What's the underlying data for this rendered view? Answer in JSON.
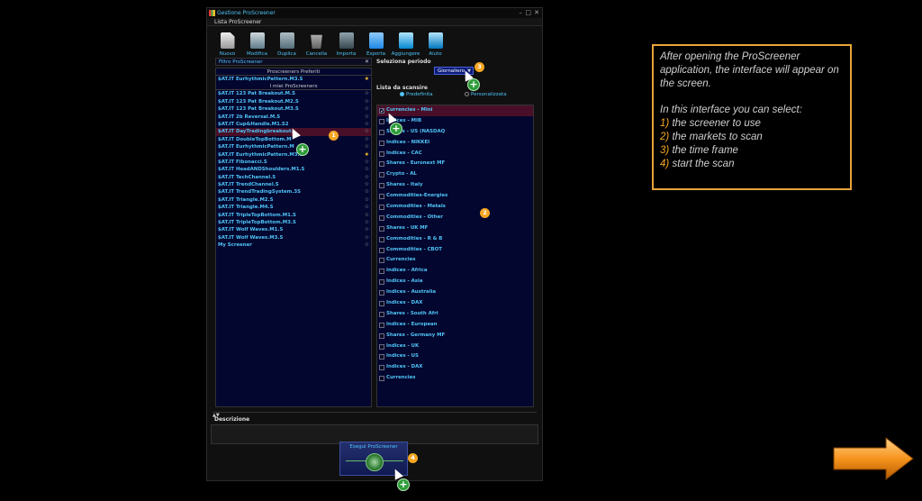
{
  "window": {
    "title": "Gestione ProScreener"
  },
  "list_header": "Lista ProScreener",
  "toolbar": [
    {
      "label": "Nuovo",
      "icon": "new-document-icon"
    },
    {
      "label": "Modifica",
      "icon": "edit-icon"
    },
    {
      "label": "Duplica",
      "icon": "duplicate-icon"
    },
    {
      "label": "Cancella",
      "icon": "trash-icon"
    },
    {
      "label": "Importa",
      "icon": "import-icon"
    },
    {
      "label": "Esporta",
      "icon": "export-icon"
    },
    {
      "label": "Aggiungere",
      "icon": "add-icon"
    },
    {
      "label": "Aiuto",
      "icon": "help-icon"
    }
  ],
  "filter": {
    "placeholder": "Filtro ProScreener"
  },
  "favorites_header": "Proscreeners Preferiti",
  "favorites": [
    {
      "label": "$AT.IT EurhythmicPattern.M3.S"
    }
  ],
  "mine_header": "I miei ProScreeners",
  "screeners": [
    {
      "label": "$AT.IT 123 Pat Breakout.M.S"
    },
    {
      "label": "$AT.IT 123 Pat Breakout.M2.S"
    },
    {
      "label": "$AT.IT 123 Pat Breakout.M3.S"
    },
    {
      "label": "$AT.IT 2b Reversal.M.S"
    },
    {
      "label": "$AT.IT Cup&Handle.M1.S2"
    },
    {
      "label": "$AT.IT DayTradingbreakout."
    },
    {
      "label": "$AT.IT DoubleTopBottom.M"
    },
    {
      "label": "$AT.IT EurhythmicPattern.M"
    },
    {
      "label": "$AT.IT EurhythmicPattern.M3.S"
    },
    {
      "label": "$AT.IT Fibonacci.S"
    },
    {
      "label": "$AT.IT HeadANDShoulders.M1.S"
    },
    {
      "label": "$AT.IT TechChannel.S"
    },
    {
      "label": "$AT.IT TrendChannel.S"
    },
    {
      "label": "$AT.IT TrendTradingSystem.3S"
    },
    {
      "label": "$AT.IT Triangle.M2.S"
    },
    {
      "label": "$AT.IT Triangle.M4.S"
    },
    {
      "label": "$AT.IT TripleTopBottom.M1.S"
    },
    {
      "label": "$AT.IT TripleTopBottom.M3.S"
    },
    {
      "label": "$AT.IT Wolf Waves.M1.S"
    },
    {
      "label": "$AT.IT Wolf Waves.M3.S"
    },
    {
      "label": "My Screener"
    }
  ],
  "period": {
    "label": "Seleziona periodo",
    "value": "Giornaliero"
  },
  "scan": {
    "label": "Lista da scansire",
    "option_default": "Predefinita",
    "option_custom": "Personalizzata"
  },
  "markets": [
    "Currencies - Mini",
    "Indices - MIB",
    "Shares - US (NASDAQ",
    "Indices - NIKKEI",
    "Indices - CAC",
    "Shares - Euronext MF",
    "Crypto - AL",
    "Shares - Italy",
    "Commodities-Energies",
    "Commodities - Metals",
    "Commodities - Other",
    "Shares - UK MF",
    "Commodities - R & B",
    "Commodities - CBOT",
    "Currencies",
    "Indices - Africa",
    "Indices - Asia",
    "Indices - Australia",
    "Indices - DAX",
    "Shares - South Afri",
    "Indices - European",
    "Shares - Germany MF",
    "Indices - UK",
    "Indices - US",
    "Indices - DAX",
    "Currencies"
  ],
  "description": {
    "label": "Descrizione"
  },
  "run": {
    "label": "Esegui ProScreener"
  },
  "markers": [
    "1",
    "2",
    "3",
    "4"
  ],
  "info": {
    "intro": "After opening the ProScreener application, the interface will appear on the screen.",
    "select": "In this interface you can select:",
    "items": [
      {
        "n": "1)",
        "text": "the screener to use"
      },
      {
        "n": "2)",
        "text": "the markets to scan"
      },
      {
        "n": "3)",
        "text": "the time frame"
      },
      {
        "n": "4)",
        "text": "start the scan"
      }
    ]
  },
  "colors": {
    "accent": "#4fc3f7",
    "marker": "#f5a623",
    "plus": "#2e9d3a",
    "selection": "#4a0f28",
    "list_bg": "#03062e",
    "info_border": "#e8a33c"
  }
}
